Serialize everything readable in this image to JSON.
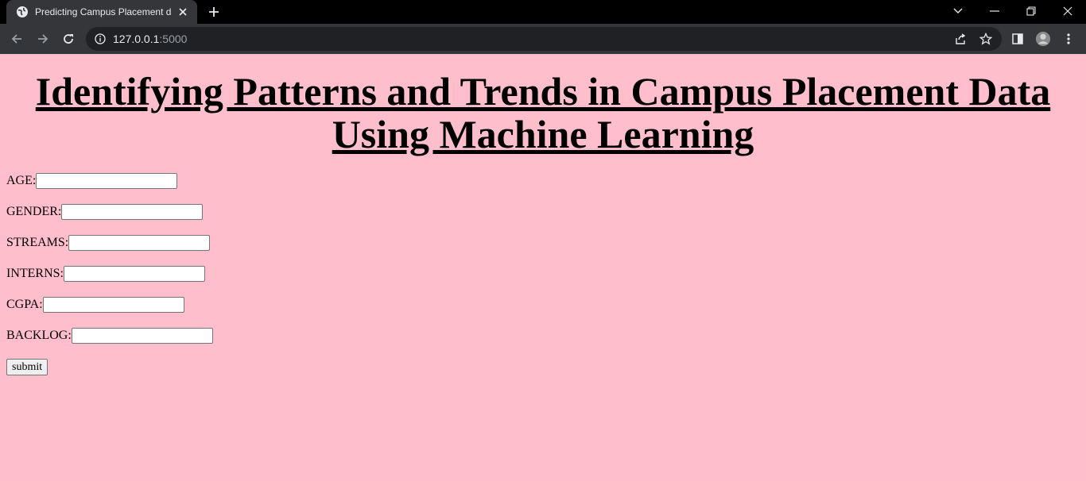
{
  "browser": {
    "tab_title": "Predicting Campus Placement da",
    "url_host": "127.0.0.1",
    "url_port": ":5000"
  },
  "page": {
    "heading_line1": "Identifying Patterns and Trends in Campus Placement Data",
    "heading_line2": "Using Machine Learning",
    "fields": [
      {
        "label": "AGE:",
        "value": ""
      },
      {
        "label": "GENDER:",
        "value": ""
      },
      {
        "label": "STREAMS:",
        "value": ""
      },
      {
        "label": "INTERNS:",
        "value": ""
      },
      {
        "label": "CGPA:",
        "value": ""
      },
      {
        "label": "BACKLOG:",
        "value": ""
      }
    ],
    "submit_label": "submit"
  },
  "colors": {
    "page_background": "#ffbecb",
    "chrome_background": "#35363a",
    "tabstrip_background": "#000000"
  }
}
